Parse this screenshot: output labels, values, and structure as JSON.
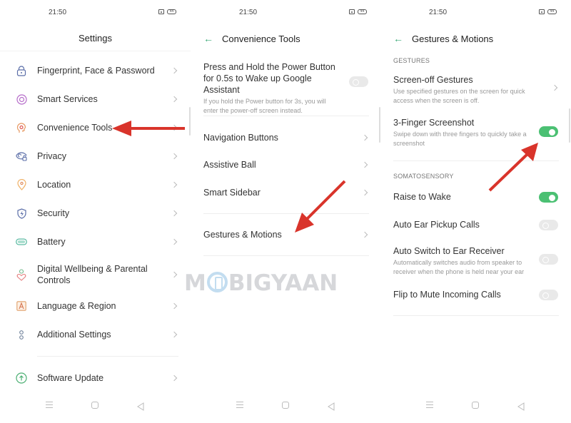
{
  "status_bar": {
    "time": "21:50",
    "battery": "44"
  },
  "panel_settings": {
    "title": "Settings",
    "items": [
      {
        "label": "Fingerprint, Face & Password",
        "icon": "lock-icon",
        "color": "#5b6ea8"
      },
      {
        "label": "Smart Services",
        "icon": "target-icon",
        "color": "#b56bc9"
      },
      {
        "label": "Convenience Tools",
        "icon": "head-gear-icon",
        "color": "#e79a63"
      },
      {
        "label": "Privacy",
        "icon": "eye-lock-icon",
        "color": "#5b6ea8"
      },
      {
        "label": "Location",
        "icon": "location-pin-icon",
        "color": "#f0b36a"
      },
      {
        "label": "Security",
        "icon": "shield-bolt-icon",
        "color": "#5b6ea8"
      },
      {
        "label": "Battery",
        "icon": "battery-icon",
        "color": "#4cb49a"
      },
      {
        "label": "Digital Wellbeing & Parental Controls",
        "icon": "person-heart-icon",
        "color": "#6fb88a"
      },
      {
        "label": "Language & Region",
        "icon": "language-a-icon",
        "color": "#e08a5a"
      },
      {
        "label": "Additional Settings",
        "icon": "dots-icon",
        "color": "#6d7f99"
      },
      {
        "label": "Software Update",
        "icon": "arrow-up-circle-icon",
        "color": "#4caf73"
      }
    ]
  },
  "panel_convenience": {
    "title": "Convenience Tools",
    "power_button": {
      "label": "Press and Hold the Power Button for 0.5s to Wake up Google Assistant",
      "description": "If you hold the Power button for 3s, you will enter the power-off screen instead.",
      "enabled": false
    },
    "items": [
      {
        "label": "Navigation Buttons"
      },
      {
        "label": "Assistive Ball"
      },
      {
        "label": "Smart Sidebar"
      },
      {
        "label": "Gestures & Motions"
      }
    ]
  },
  "panel_gestures": {
    "title": "Gestures & Motions",
    "section_gestures": "GESTURES",
    "screen_off": {
      "label": "Screen-off Gestures",
      "description": "Use specified gestures on the screen for quick access when the screen is off."
    },
    "three_finger": {
      "label": "3-Finger Screenshot",
      "description": "Swipe down with three fingers to quickly take a screenshot",
      "enabled": true
    },
    "section_somatosensory": "SOMATOSENSORY",
    "raise_to_wake": {
      "label": "Raise to Wake",
      "enabled": true
    },
    "auto_ear_pickup": {
      "label": "Auto Ear Pickup Calls",
      "enabled": false
    },
    "auto_switch": {
      "label": "Auto Switch to Ear Receiver",
      "description": "Automatically switches audio from speaker to receiver when the phone is held near your ear",
      "enabled": false
    },
    "flip_to_mute": {
      "label": "Flip to Mute Incoming Calls",
      "enabled": false
    }
  },
  "watermark": {
    "text_m": "M",
    "text_rest": "BIGYAAN"
  },
  "annotation_color": "#d9342b"
}
